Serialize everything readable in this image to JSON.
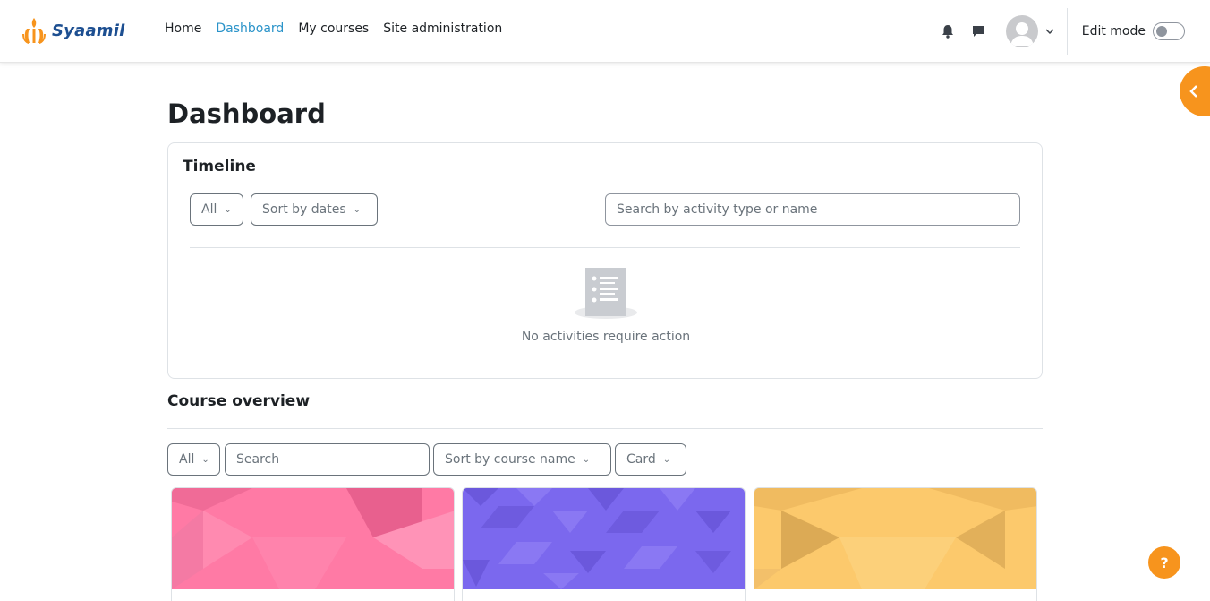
{
  "brand": {
    "name": "Syaamil",
    "accent": "#f7941d",
    "text_color": "#1d4f91"
  },
  "nav": {
    "links": [
      {
        "label": "Home",
        "active": false
      },
      {
        "label": "Dashboard",
        "active": true
      },
      {
        "label": "My courses",
        "active": false
      },
      {
        "label": "Site administration",
        "active": false
      }
    ],
    "icons": [
      "bell-icon",
      "chat-icon",
      "avatar",
      "chevron-down-icon"
    ],
    "edit_mode_label": "Edit mode",
    "edit_mode_on": false
  },
  "page": {
    "title": "Dashboard"
  },
  "timeline": {
    "title": "Timeline",
    "filter_label": "All",
    "sort_label": "Sort by dates",
    "search_placeholder": "Search by activity type or name",
    "empty_message": "No activities require action"
  },
  "course_overview": {
    "title": "Course overview",
    "filter_label": "All",
    "search_placeholder": "Search",
    "sort_label": "Sort by course name",
    "view_label": "Card",
    "cards": [
      {
        "pattern_color": "#ff7aa5"
      },
      {
        "pattern_color": "#7b68ee"
      },
      {
        "pattern_color": "#fcc96c"
      }
    ]
  },
  "help": {
    "label": "?"
  }
}
